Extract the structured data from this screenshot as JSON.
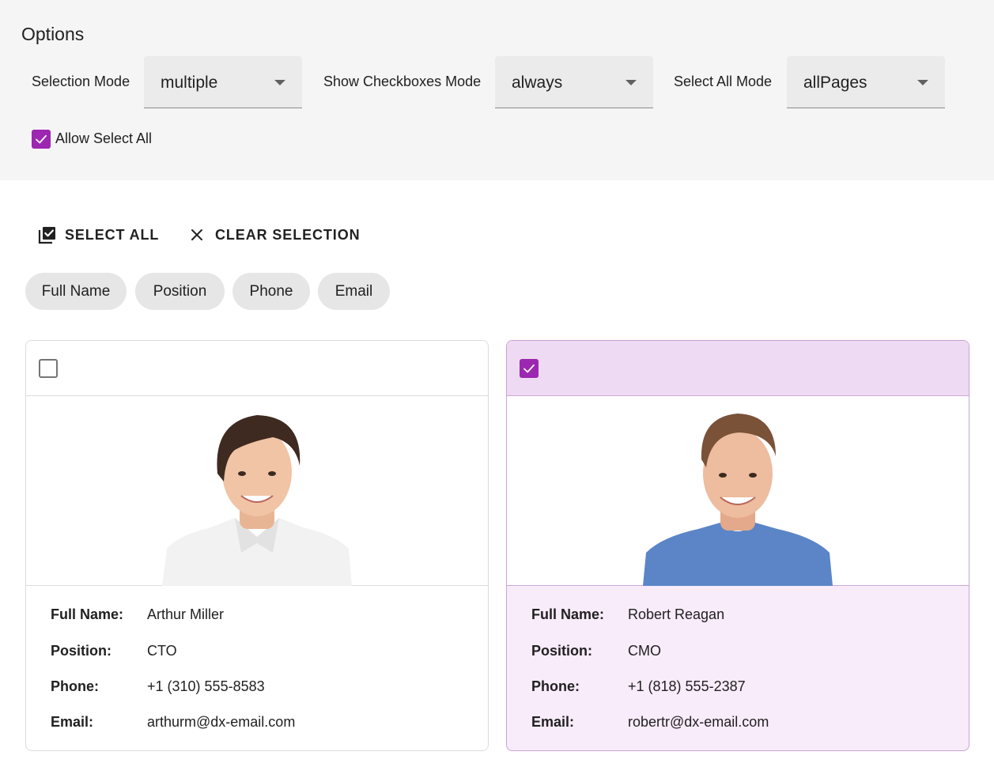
{
  "options": {
    "title": "Options",
    "selection_mode": {
      "label": "Selection Mode",
      "value": "multiple"
    },
    "show_checkboxes_mode": {
      "label": "Show Checkboxes Mode",
      "value": "always"
    },
    "select_all_mode": {
      "label": "Select All Mode",
      "value": "allPages"
    },
    "allow_select_all": {
      "label": "Allow Select All",
      "checked": true
    }
  },
  "toolbar": {
    "select_all_label": "SELECT ALL",
    "clear_selection_label": "CLEAR SELECTION"
  },
  "chips": [
    "Full Name",
    "Position",
    "Phone",
    "Email"
  ],
  "field_labels": {
    "full_name": "Full Name:",
    "position": "Position:",
    "phone": "Phone:",
    "email": "Email:"
  },
  "cards": [
    {
      "selected": false,
      "full_name": "Arthur Miller",
      "position": "CTO",
      "phone": "+1 (310) 555-8583",
      "email": "arthurm@dx-email.com"
    },
    {
      "selected": true,
      "full_name": "Robert Reagan",
      "position": "CMO",
      "phone": "+1 (818) 555-2387",
      "email": "robertr@dx-email.com"
    }
  ],
  "colors": {
    "accent": "#9c27b0",
    "selected_card_bg": "#f8ebfa",
    "options_bg": "#f5f5f5"
  }
}
